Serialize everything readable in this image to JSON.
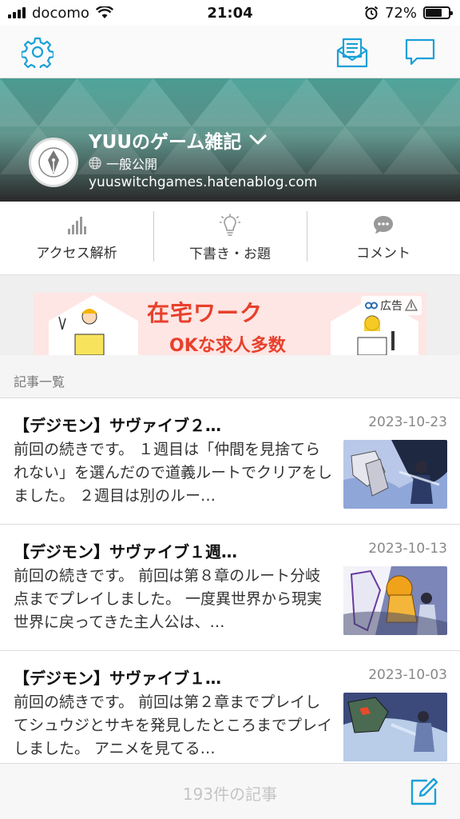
{
  "status_bar": {
    "carrier": "docomo",
    "time": "21:04",
    "battery": "72%",
    "battery_level": 0.72
  },
  "toolbar": {
    "settings_icon": "gear-icon",
    "subscribe_icon": "envelope-icon",
    "message_icon": "speech-bubble-icon",
    "accent": "#1aa0d8"
  },
  "blog": {
    "title": "YUUのゲーム雑記",
    "visibility": "一般公開",
    "url": "yuuswitchgames.hatenablog.com"
  },
  "actions": [
    {
      "label": "アクセス解析",
      "icon": "bar-chart-icon"
    },
    {
      "label": "下書き・お題",
      "icon": "lightbulb-icon"
    },
    {
      "label": "コメント",
      "icon": "comment-icon"
    }
  ],
  "ad": {
    "headline": "在宅ワーク",
    "subline": "OKな求人多数",
    "label": "広告"
  },
  "section": {
    "title": "記事一覧"
  },
  "articles": [
    {
      "title": "【デジモン】サヴァイブ２…",
      "date": "2023-10-23",
      "excerpt": "前回の続きです。 １週目は「仲間を見捨てられない」を選んだので道義ルートでクリアをしました。 ２週目は別のルー…"
    },
    {
      "title": "【デジモン】サヴァイブ１週…",
      "date": "2023-10-13",
      "excerpt": "前回の続きです。 前回は第８章のルート分岐点までプレイしました。 一度異世界から現実世界に戻ってきた主人公は、…"
    },
    {
      "title": "【デジモン】サヴァイブ１…",
      "date": "2023-10-03",
      "excerpt": "前回の続きです。 前回は第２章までプレイしてシュウジとサキを発見したところまでプレイしました。 アニメを見てる…"
    }
  ],
  "footer": {
    "count": "193件の記事",
    "compose_icon": "compose-icon"
  }
}
